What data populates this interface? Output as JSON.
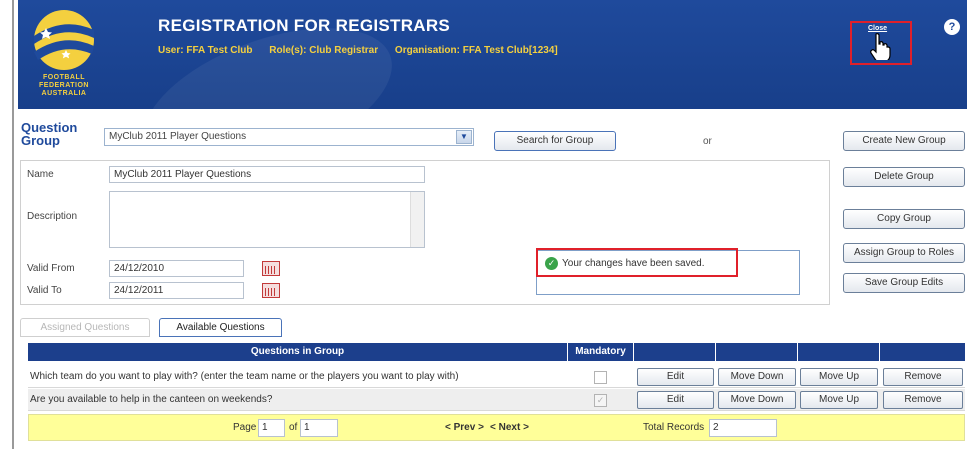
{
  "header": {
    "title": "REGISTRATION FOR REGISTRARS",
    "user": "User: FFA Test Club",
    "roles": "Role(s): Club Registrar",
    "organisation": "Organisation: FFA Test Club[1234]",
    "logo_text": [
      "FOOTBALL",
      "FEDERATION",
      "AUSTRALIA"
    ],
    "close_label": "Close",
    "help_label": "?"
  },
  "question_group": {
    "label_line1": "Question",
    "label_line2": "Group",
    "selected": "MyClub 2011 Player Questions",
    "search_button": "Search for Group",
    "or_text": "or"
  },
  "actions": {
    "create": "Create New Group",
    "delete": "Delete Group",
    "copy": "Copy Group",
    "assign": "Assign Group to Roles",
    "save": "Save Group Edits"
  },
  "form": {
    "name_label": "Name",
    "name_value": "MyClub 2011 Player Questions",
    "description_label": "Description",
    "description_value": "",
    "valid_from_label": "Valid From",
    "valid_from_value": "24/12/2010",
    "valid_to_label": "Valid To",
    "valid_to_value": "24/12/2011"
  },
  "message": {
    "text": "Your changes have been saved."
  },
  "tabs": {
    "assigned": "Assigned Questions",
    "available": "Available Questions"
  },
  "table": {
    "headers": [
      "Questions in Group",
      "Mandatory",
      "",
      "",
      "",
      ""
    ],
    "rows": [
      {
        "question": "Which team do you want to play with? (enter the team name or the players you want to play with)",
        "mandatory": false,
        "edit": "Edit",
        "move_down": "Move Down",
        "move_up": "Move Up",
        "remove": "Remove"
      },
      {
        "question": "Are you available to help in the canteen on weekends?",
        "mandatory": true,
        "edit": "Edit",
        "move_down": "Move Down",
        "move_up": "Move Up",
        "remove": "Remove"
      }
    ]
  },
  "pager": {
    "page_label": "Page",
    "page_value": "1",
    "of_label": "of",
    "of_value": "1",
    "prev": "< Prev >",
    "next": "< Next >",
    "total_label": "Total Records",
    "total_value": "2"
  },
  "colors": {
    "header_blue": "#1f4a9c",
    "accent_yellow": "#f4d03f",
    "highlight_red": "#e0202a",
    "pager_yellow": "#ffff99"
  }
}
